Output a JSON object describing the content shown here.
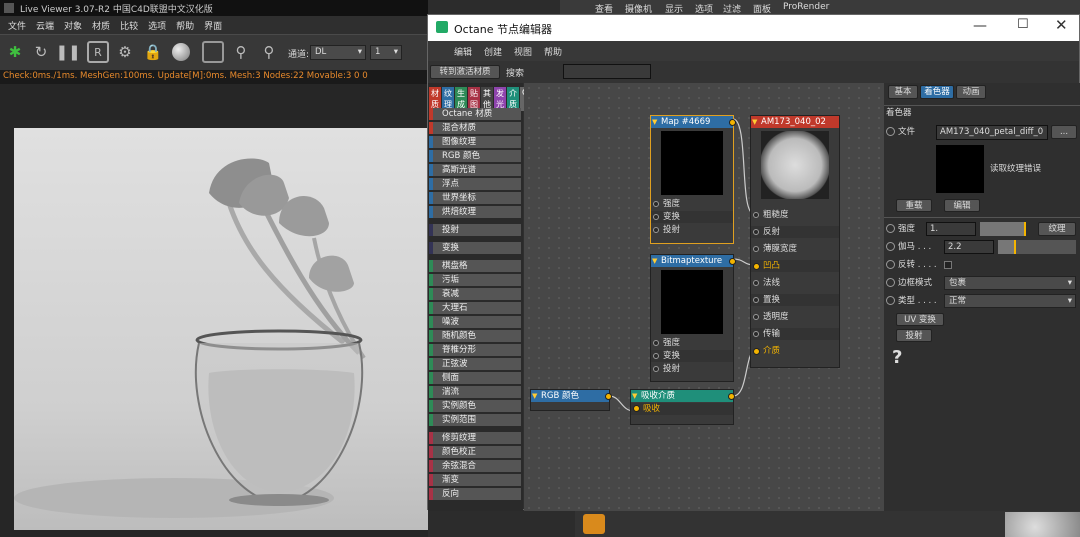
{
  "bg": {
    "menu_fragments": [
      "查看",
      "摄像机",
      "显示",
      "选项",
      "过滤",
      "面板",
      "ProRender"
    ]
  },
  "lv": {
    "title": "Live Viewer 3.07-R2 中国C4D联盟中文汉化版",
    "menu": [
      "文件",
      "云端",
      "对象",
      "材质",
      "比较",
      "选项",
      "帮助",
      "界面"
    ],
    "channel_label": "通道:",
    "channel_value": "DL",
    "num_value": "1",
    "status": "Check:0ms./1ms. MeshGen:100ms. Update[M]:0ms. Mesh:3 Nodes:22 Movable:3  0 0"
  },
  "oct": {
    "title": "Octane 节点编辑器",
    "menu": [
      "编辑",
      "创建",
      "视图",
      "帮助"
    ],
    "goto_btn": "转到激活材质",
    "search_label": "搜索",
    "tabs": [
      {
        "label": "材质",
        "color": "#c0392b"
      },
      {
        "label": "纹理",
        "color": "#2e6da4"
      },
      {
        "label": "生成",
        "color": "#2e8b57"
      },
      {
        "label": "贴图",
        "color": "#a83246"
      },
      {
        "label": "其他",
        "color": "#444444"
      },
      {
        "label": "发光",
        "color": "#8e44ad"
      },
      {
        "label": "介质",
        "color": "#1f8f7a"
      },
      {
        "label": "C4D",
        "color": "#666666"
      }
    ],
    "library": [
      {
        "label": "Octane 材质",
        "color": "#c0392b"
      },
      {
        "label": "混合材质",
        "color": "#c0392b"
      },
      {
        "label": "图像纹理",
        "color": "#2e6da4"
      },
      {
        "label": "RGB 颜色",
        "color": "#2e6da4"
      },
      {
        "label": "高斯光谱",
        "color": "#2e6da4"
      },
      {
        "label": "浮点",
        "color": "#2e6da4"
      },
      {
        "label": "世界坐标",
        "color": "#2e6da4"
      },
      {
        "label": "烘焙纹理",
        "color": "#2e6da4"
      },
      {
        "label": "投射",
        "color": "#333355"
      },
      {
        "label": "变换",
        "color": "#333355"
      },
      {
        "label": "棋盘格",
        "color": "#2e8b57"
      },
      {
        "label": "污垢",
        "color": "#2e8b57"
      },
      {
        "label": "衰减",
        "color": "#2e8b57"
      },
      {
        "label": "大理石",
        "color": "#2e8b57"
      },
      {
        "label": "噪波",
        "color": "#2e8b57"
      },
      {
        "label": "随机颜色",
        "color": "#2e8b57"
      },
      {
        "label": "脊椎分形",
        "color": "#2e8b57"
      },
      {
        "label": "正弦波",
        "color": "#2e8b57"
      },
      {
        "label": "侧面",
        "color": "#2e8b57"
      },
      {
        "label": "湍流",
        "color": "#2e8b57"
      },
      {
        "label": "实例颜色",
        "color": "#2e8b57"
      },
      {
        "label": "实例范围",
        "color": "#2e8b57"
      },
      {
        "label": "修剪纹理",
        "color": "#a83246"
      },
      {
        "label": "颜色校正",
        "color": "#a83246"
      },
      {
        "label": "余弦混合",
        "color": "#a83246"
      },
      {
        "label": "渐变",
        "color": "#a83246"
      },
      {
        "label": "反向",
        "color": "#a83246"
      }
    ],
    "nodes": {
      "map": {
        "title": "Map #4669",
        "ports": [
          "强度",
          "变换",
          "投射"
        ]
      },
      "bitmap": {
        "title": "Bitmaptexture",
        "ports": [
          "强度",
          "变换",
          "投射"
        ]
      },
      "mat": {
        "title": "AM173_040_02",
        "ports": [
          "粗糙度",
          "反射",
          "薄膜宽度",
          "凹凸",
          "法线",
          "置换",
          "透明度",
          "传输",
          "介质"
        ]
      },
      "rgb": {
        "title": "RGB 颜色"
      },
      "absorb": {
        "title": "吸收介质",
        "ports": [
          "吸收"
        ]
      }
    },
    "attr": {
      "tabs": [
        "基本",
        "着色器",
        "动画"
      ],
      "section": "着色器",
      "file_label": "文件",
      "file_value": "AM173_040_petal_diff_0",
      "file_btn": "...",
      "read_error": "读取纹理错误",
      "reload_btn": "重载",
      "edit_btn": "编辑",
      "power_label": "强度",
      "power_value": "1.",
      "texture_btn": "纹理",
      "gamma_label": "伽马 . . .",
      "gamma_value": "2.2",
      "invert_label": "反转 . . . .",
      "border_label": "边框模式",
      "border_value": "包裹",
      "type_label": "类型 . . . .",
      "type_value": "正常",
      "uv_btn": "UV 变换",
      "proj_btn": "投射",
      "help": "?"
    }
  }
}
